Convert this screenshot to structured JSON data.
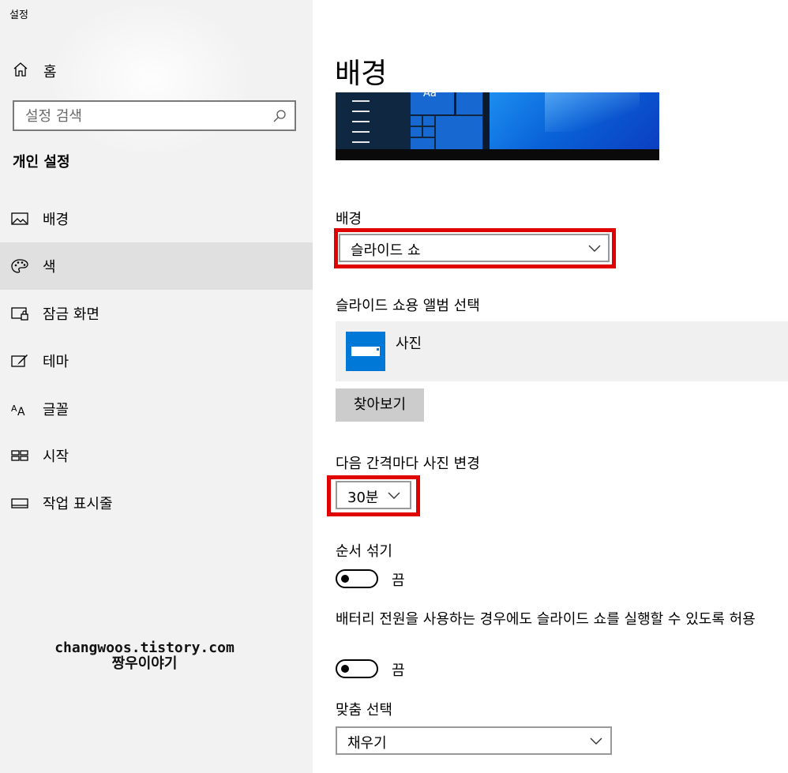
{
  "app": {
    "title": "설정"
  },
  "sidebar": {
    "home_label": "홈",
    "search_placeholder": "설정 검색",
    "section_title": "개인 설정",
    "items": [
      {
        "label": "배경",
        "icon": "picture-icon"
      },
      {
        "label": "색",
        "icon": "palette-icon",
        "selected": true
      },
      {
        "label": "잠금 화면",
        "icon": "lock-screen-icon"
      },
      {
        "label": "테마",
        "icon": "theme-brush-icon"
      },
      {
        "label": "글꼴",
        "icon": "font-icon"
      },
      {
        "label": "시작",
        "icon": "start-grid-icon"
      },
      {
        "label": "작업 표시줄",
        "icon": "taskbar-icon"
      }
    ]
  },
  "watermark": {
    "line1": "changwoos.tistory.com",
    "line2": "짱우이야기"
  },
  "main": {
    "title": "배경",
    "preview": {
      "tile_text": "Aa"
    },
    "background": {
      "label": "배경",
      "value": "슬라이드 쇼"
    },
    "album": {
      "label": "슬라이드 쇼용 앨범 선택",
      "name": "사진",
      "browse_label": "찾아보기"
    },
    "interval": {
      "label": "다음 간격마다 사진 변경",
      "value": "30분"
    },
    "shuffle": {
      "label": "순서 섞기",
      "state": "끔"
    },
    "battery": {
      "label": "배터리 전원을 사용하는 경우에도 슬라이드 쇼를 실행할 수 있도록 허용",
      "state": "끔"
    },
    "fit": {
      "label": "맞춤 선택",
      "value": "채우기"
    }
  },
  "colors": {
    "accent": "#0078d7",
    "highlight": "#e00000",
    "sidebar_bg": "#f2f2f2",
    "selected_bg": "#e0e0e0"
  }
}
